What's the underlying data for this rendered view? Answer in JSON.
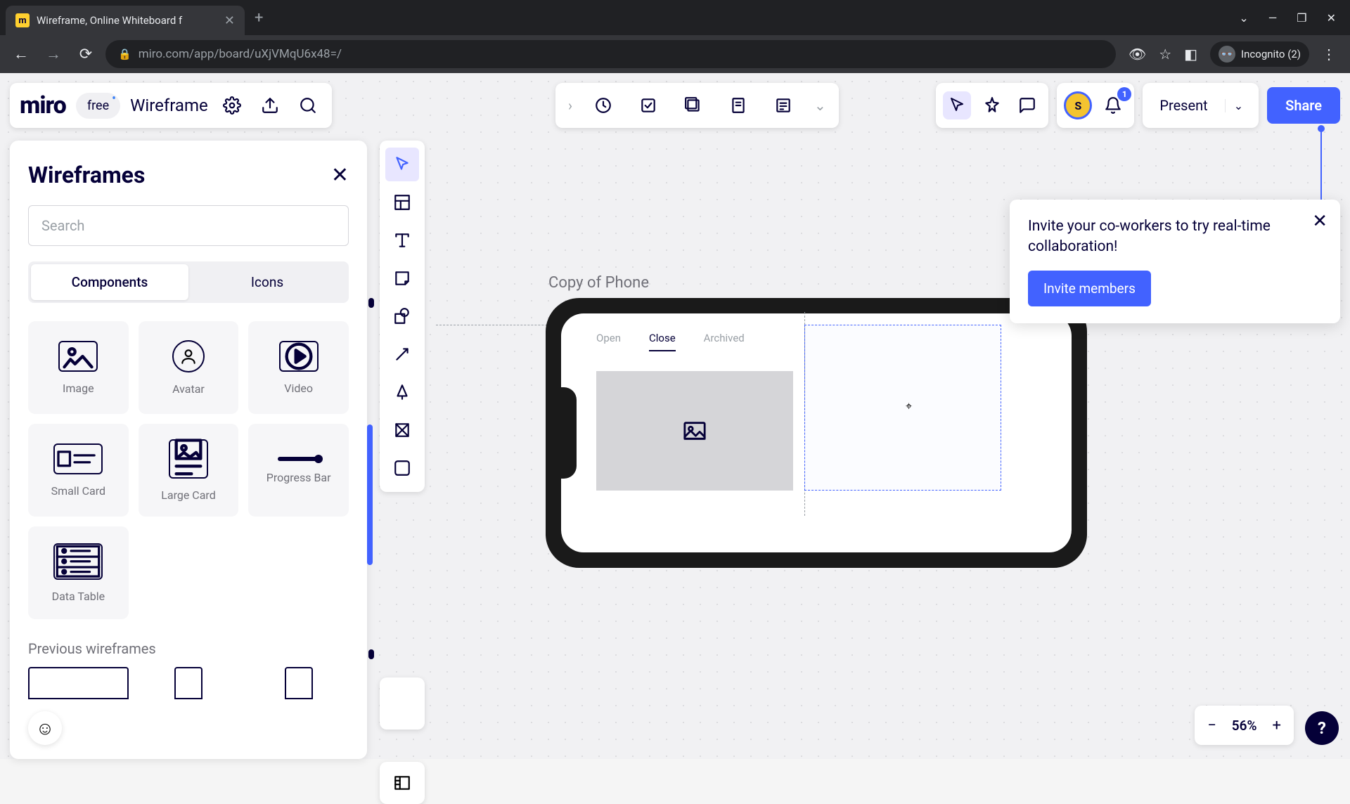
{
  "browser": {
    "tab_title": "Wireframe, Online Whiteboard f",
    "url": "miro.com/app/board/uXjVMqU6x48=/",
    "incognito_label": "Incognito (2)"
  },
  "brand": {
    "logo_text": "miro",
    "plan": "free",
    "board_name": "Wireframe"
  },
  "share": {
    "present": "Present",
    "share": "Share",
    "notif_count": "1",
    "avatar_initial": "S"
  },
  "panel": {
    "title": "Wireframes",
    "search_placeholder": "Search",
    "seg_components": "Components",
    "seg_icons": "Icons",
    "components": [
      {
        "label": "Image"
      },
      {
        "label": "Avatar"
      },
      {
        "label": "Video"
      },
      {
        "label": "Small Card"
      },
      {
        "label": "Large Card"
      },
      {
        "label": "Progress Bar"
      },
      {
        "label": "Data Table"
      }
    ],
    "prev_title": "Previous wireframes"
  },
  "canvas": {
    "frame_label": "Copy of Phone",
    "tabs": {
      "open": "Open",
      "close": "Close",
      "archived": "Archived"
    }
  },
  "invite": {
    "message": "Invite your co-workers to try real-time collaboration!",
    "button": "Invite members"
  },
  "zoom": {
    "value": "56%"
  }
}
